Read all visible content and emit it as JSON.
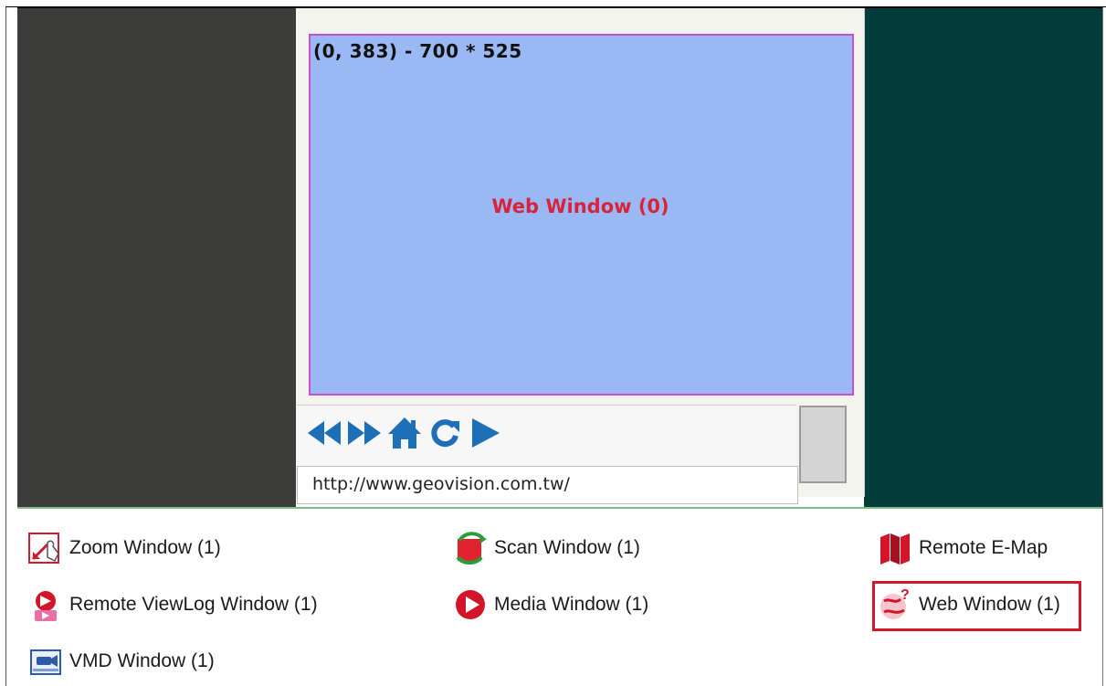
{
  "preview": {
    "coordinates": "(0, 383) - 700 * 525",
    "window_label": "Web Window (0)",
    "url": "http://www.geovision.com.tw/"
  },
  "nav": {
    "icons": [
      "back-icon",
      "forward-icon",
      "home-icon",
      "refresh-icon",
      "play-icon"
    ]
  },
  "menu": {
    "zoom_window": "Zoom Window (1)",
    "scan_window": "Scan Window (1)",
    "remote_emap": "Remote E-Map",
    "remote_viewlog": "Remote ViewLog Window (1)",
    "media_window": "Media Window (1)",
    "web_window": "Web Window (1)",
    "vmd_window": "VMD Window (1)"
  },
  "colors": {
    "web_area": "#9ab8f4",
    "web_label": "#d8243a",
    "highlight": "#d11a2e",
    "left_panel": "#3c3d3b",
    "right_panel": "#023d3b"
  }
}
